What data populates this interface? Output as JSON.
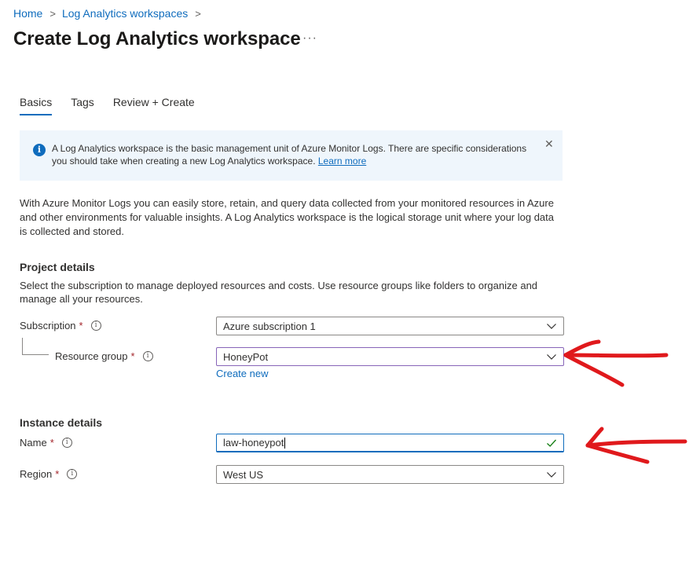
{
  "breadcrumb": {
    "home": "Home",
    "parent": "Log Analytics workspaces",
    "separator": ">"
  },
  "page": {
    "title": "Create Log Analytics workspace",
    "more": "···"
  },
  "tabs": [
    {
      "label": "Basics",
      "active": true
    },
    {
      "label": "Tags",
      "active": false
    },
    {
      "label": "Review + Create",
      "active": false
    }
  ],
  "info_banner": {
    "text": "A Log Analytics workspace is the basic management unit of Azure Monitor Logs. There are specific considerations you should take when creating a new Log Analytics workspace.",
    "link": "Learn more",
    "close": "✕"
  },
  "description": "With Azure Monitor Logs you can easily store, retain, and query data collected from your monitored resources in Azure and other environments for valuable insights. A Log Analytics workspace is the logical storage unit where your log data is collected and stored.",
  "project_details": {
    "title": "Project details",
    "description": "Select the subscription to manage deployed resources and costs. Use resource groups like folders to organize and manage all your resources.",
    "subscription_label": "Subscription",
    "subscription_value": "Azure subscription 1",
    "resource_group_label": "Resource group",
    "resource_group_value": "HoneyPot",
    "create_new": "Create new"
  },
  "instance_details": {
    "title": "Instance details",
    "name_label": "Name",
    "name_value": "law-honeypot",
    "region_label": "Region",
    "region_value": "West US"
  },
  "required_marker": "*",
  "info_marker": "i",
  "colors": {
    "accent": "#0f6cbd",
    "required": "#a4262c",
    "valid": "#107c10",
    "annotation_arrow": "#e0191c",
    "banner_bg": "#eff6fc"
  }
}
